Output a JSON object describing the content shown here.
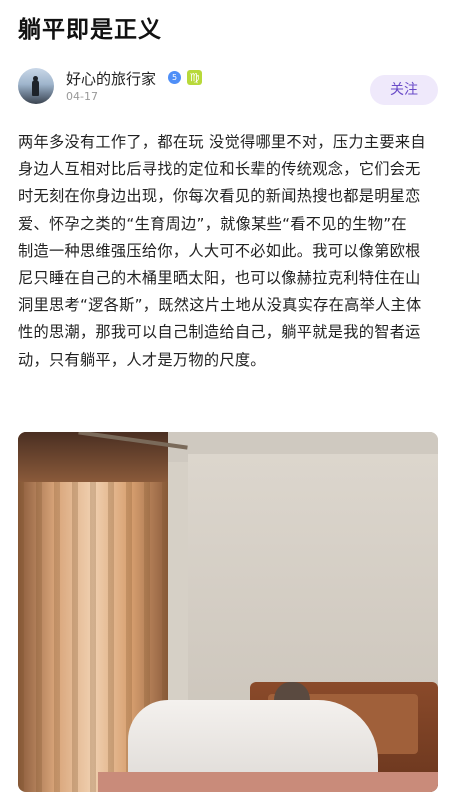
{
  "post": {
    "title": "躺平即是正义",
    "author": {
      "name": "好心的旅行家",
      "level_badge": "5",
      "zodiac_badge": "♍",
      "date": "04-17"
    },
    "follow_label": "关注",
    "body_lines": [
      "两年多没有工作了，都在玩 没觉得哪里不对，压力主要来自",
      "身边人互相对比后寻找的定位和长辈的传统观念，它们会无",
      "时无刻在你身边出现，你每次看见的新闻热搜也都是明星恋",
      "爱、怀孕之类的“生育周边”，就像某些“看不见的生物”在",
      "制造一种思维强压给你，人大可不必如此。我可以像第欧根",
      "尼只睡在自己的木桶里晒太阳，也可以像赫拉克利特住在山",
      "洞里思考“逻各斯”，既然这片土地从没真实存在高举人主体",
      "性的思潮，那我可以自己制造给自己，躺平就是我的智者运",
      "动，只有躺平，人才是万物的尺度。"
    ]
  },
  "colors": {
    "follow_bg": "#efe9fb",
    "follow_text": "#6a4bc8",
    "level_badge": "#4f8ff7",
    "zodiac_badge": "#b8d93a"
  }
}
